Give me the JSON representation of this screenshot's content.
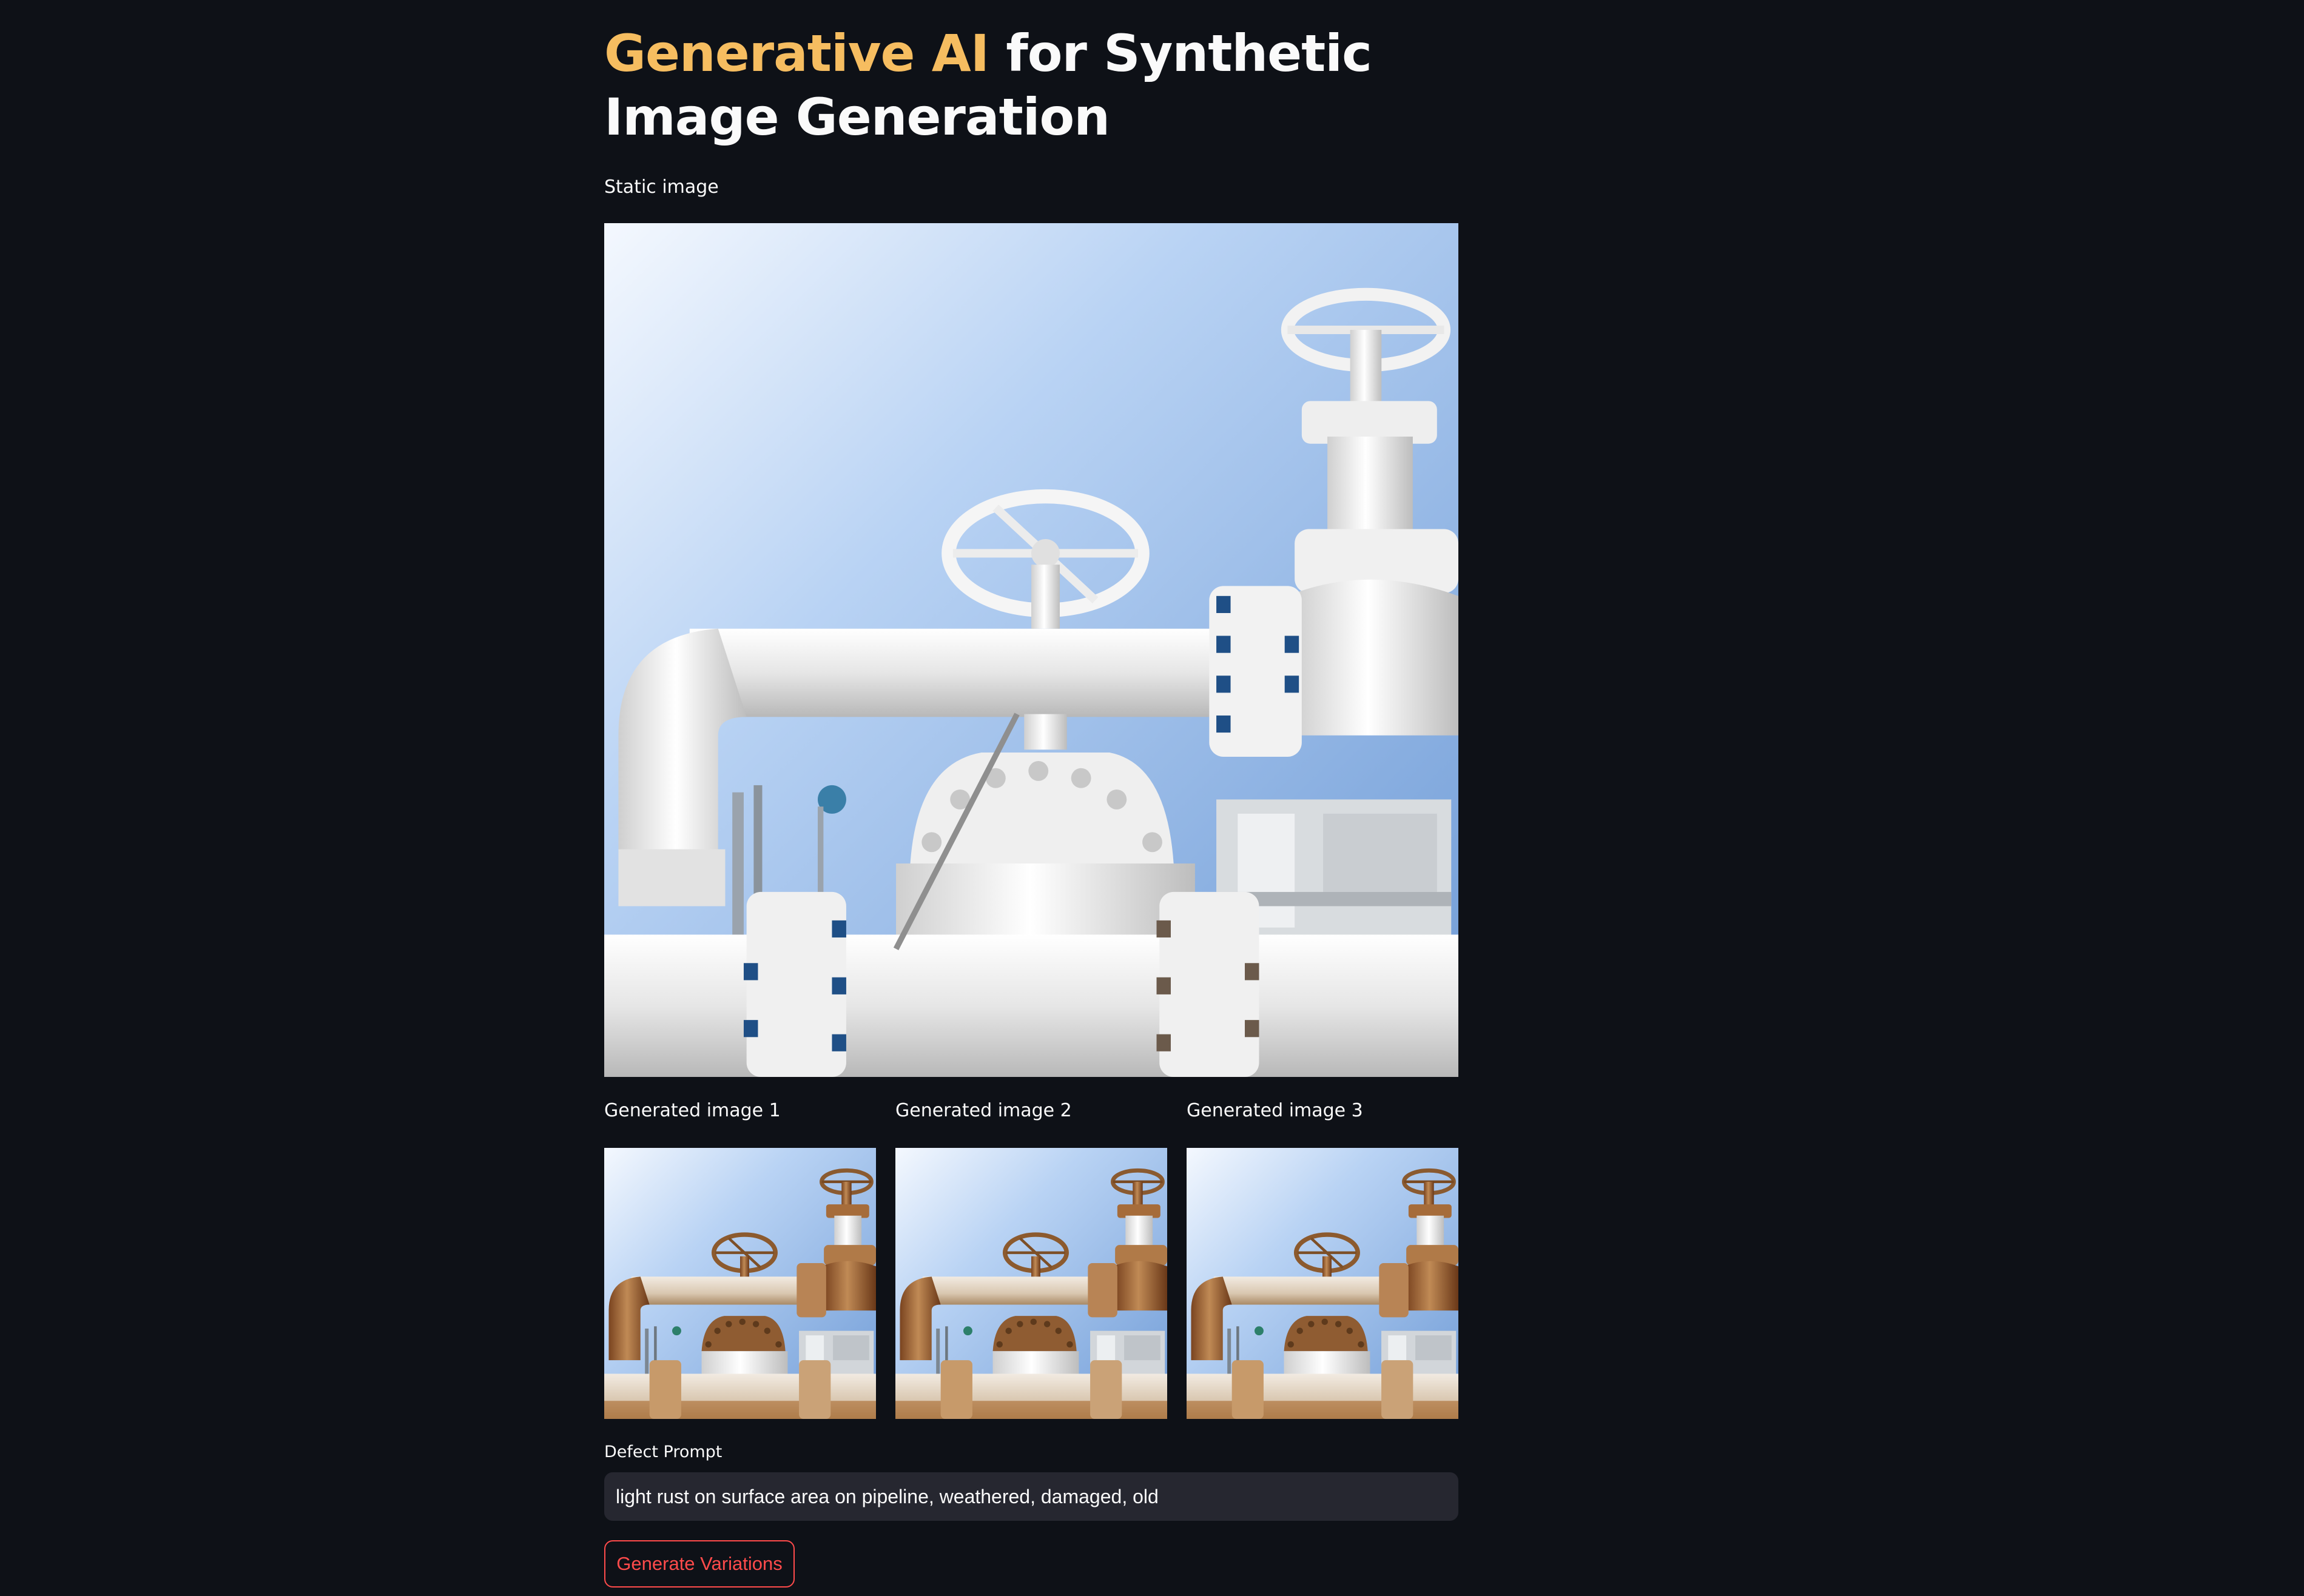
{
  "header": {
    "title_accent": "Generative AI",
    "title_rest": " for Synthetic Image Generation"
  },
  "static_section": {
    "label": "Static image"
  },
  "generated": [
    {
      "label": "Generated image 1"
    },
    {
      "label": "Generated image 2"
    },
    {
      "label": "Generated image 3"
    }
  ],
  "form": {
    "prompt_label": "Defect Prompt",
    "prompt_value": "light rust on surface area on pipeline, weathered, damaged, old",
    "button_label": "Generate Variations"
  },
  "colors": {
    "background": "#0e1117",
    "accent": "#f6bd60",
    "button": "#ff4b4b",
    "input_bg": "#262730",
    "text": "#fafafa"
  }
}
